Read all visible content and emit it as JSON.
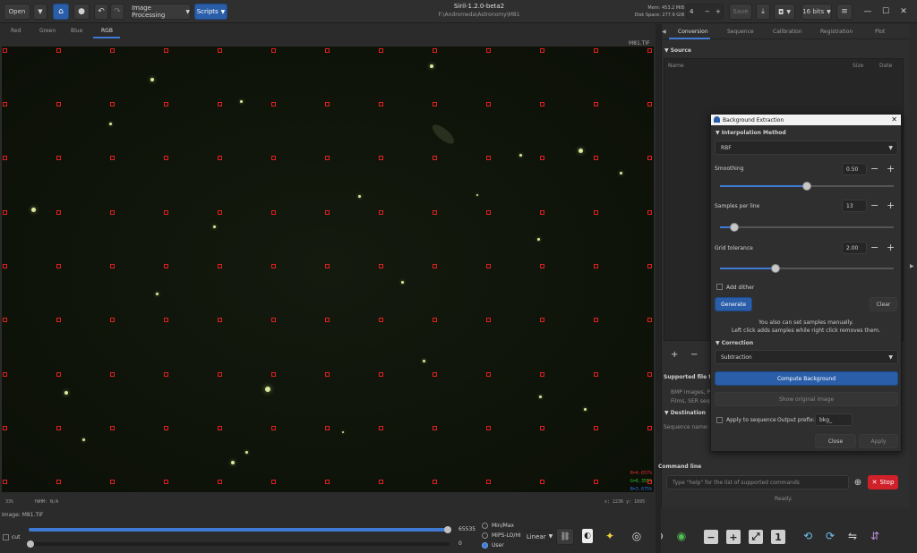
{
  "header": {
    "open_label": "Open",
    "image_processing_label": "Image Processing",
    "scripts_label": "Scripts",
    "title": "Siril-1.2.0-beta2",
    "path": "F:\\Andromeda\\Astronomy\\M81",
    "mem": "Mem: 453.2 MiB",
    "disk": "Disk Space: 277.9 GiB",
    "thread_value": "4",
    "save_label": "Save",
    "bits_label": "16 bits"
  },
  "viewer": {
    "tabs": [
      "Red",
      "Green",
      "Blue",
      "RGB"
    ],
    "active_tab": "RGB",
    "filename_top": "M81.TIF",
    "r_value": "R=4.657%",
    "g_value": "G=6.355%",
    "b_value": "B=3.675%",
    "zoom": "33%",
    "fwhm": "fWHM: N/A",
    "coords": "x: 2236  y: 1695",
    "image_label": "Image: M81.TIF"
  },
  "bottom": {
    "cut_label": "cut",
    "max_value": "65535",
    "min_value": "0",
    "radio_minmax": "Min/Max",
    "radio_mipshi": "MIPS-LO/HI",
    "radio_user": "User",
    "stretch_label": "Linear"
  },
  "right": {
    "tabs": [
      "Conversion",
      "Sequence",
      "Calibration",
      "Registration",
      "Plot"
    ],
    "source_header": "Source",
    "col_name": "Name",
    "col_size": "Size",
    "col_date": "Date",
    "add_sign": "+",
    "remove_sign": "−",
    "supported_label": "Supported file typ",
    "supported_line1": "BMP images, PI",
    "supported_line2": "Films, SER seque",
    "destination_header": "Destination",
    "sequence_name_label": "Sequence name:",
    "command_line_label": "Command line",
    "command_placeholder": "Type \"help\" for the list of supported commands",
    "stop_label": "Stop",
    "ready_label": "Ready."
  },
  "dialog": {
    "title": "Background Extraction",
    "interp_header": "Interpolation Method",
    "interp_value": "RBF",
    "smoothing_label": "Smoothing",
    "smoothing_value": "0.50",
    "smoothing_level": 0.5,
    "samples_label": "Samples per line",
    "samples_value": "13",
    "samples_level": 0.08,
    "tolerance_label": "Grid tolerance",
    "tolerance_value": "2.00",
    "tolerance_level": 0.32,
    "add_dither_label": "Add dither",
    "generate_label": "Generate",
    "clear_label": "Clear",
    "hint1": "You also can set samples manually.",
    "hint2": "Left click adds samples while right click removes them.",
    "correction_header": "Correction",
    "correction_value": "Subtraction",
    "compute_label": "Compute Background",
    "show_original_label": "Show original image",
    "apply_seq_label": "Apply to sequence",
    "output_prefix_label": "Output prefix:",
    "output_prefix_value": "bkg_",
    "close_label": "Close",
    "apply_label": "Apply"
  }
}
